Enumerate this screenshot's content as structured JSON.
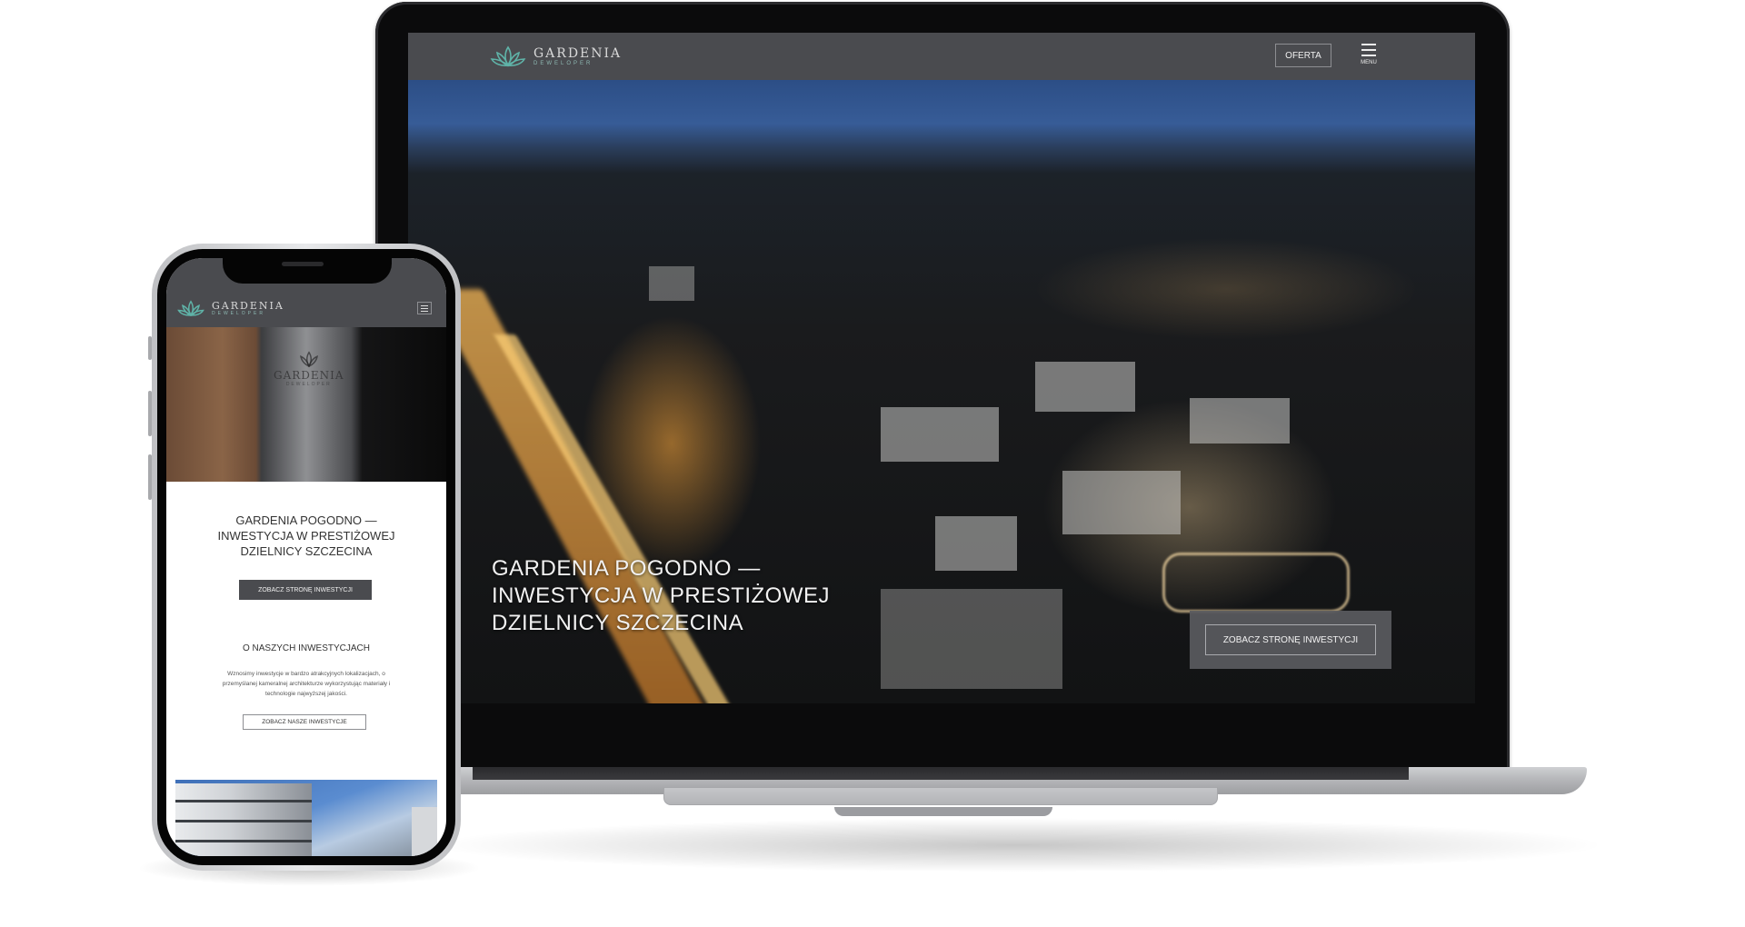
{
  "brand": {
    "name": "GARDENIA",
    "sub": "DEWELOPER",
    "accent": "#5fb3a8"
  },
  "laptop": {
    "header": {
      "oferta_label": "OFERTA",
      "menu_label": "MENU"
    },
    "hero": {
      "title_lines": [
        "GARDENIA POGODNO —",
        "INWESTYCJA W PRESTIŻOWEJ",
        "DZIELNICY SZCZECINA"
      ],
      "cta_label": "ZOBACZ STRONĘ INWESTYCJI"
    }
  },
  "phone": {
    "headline_lines": [
      "GARDENIA POGODNO —",
      "INWESTYCJA W PRESTIŻOWEJ",
      "DZIELNICY SZCZECINA"
    ],
    "cta_label": "ZOBACZ STRONĘ INWESTYCJI",
    "section_title": "O NASZYCH INWESTYCJACH",
    "section_text_lines": [
      "Wznosimy inwestycje w bardzo atrakcyjnych lokalizacjach, o",
      "przemyślanej kameralnej architekturze wykorzystując materiały i",
      "technologie najwyższej jakości."
    ],
    "secondary_cta_label": "ZOBACZ NASZE INWESTYCJE"
  },
  "colors": {
    "header_bg": "#4a4b4f",
    "cta_bg": "#5a5b60"
  }
}
